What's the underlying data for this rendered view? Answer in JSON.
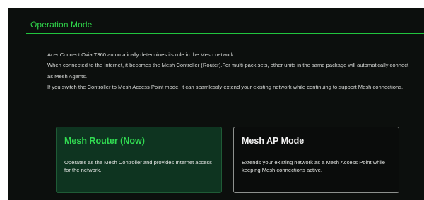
{
  "section": {
    "title": "Operation Mode"
  },
  "description": {
    "lines": [
      "Acer Connect Ovia T360 automatically determines its role in the Mesh network.",
      "When connected to the Internet, it becomes the Mesh Controller (Router).For multi-pack sets, other units in the same package will automatically connect as Mesh Agents.",
      "If you switch the Controller to Mesh Access Point mode, it can seamlessly extend your existing network while continuing to support Mesh connections."
    ]
  },
  "modes": [
    {
      "title": "Mesh Router (Now)",
      "description": "Operates as the Mesh Controller and provides Internet access for the network.",
      "selected": true
    },
    {
      "title": "Mesh AP Mode",
      "description": "Extends your existing network as a Mesh Access Point while keeping Mesh connections active.",
      "selected": false
    }
  ],
  "colors": {
    "accent": "#2fd64a",
    "background": "#0c0f0d",
    "selected_card": "#0e3420",
    "card_border": "#8d918e"
  }
}
